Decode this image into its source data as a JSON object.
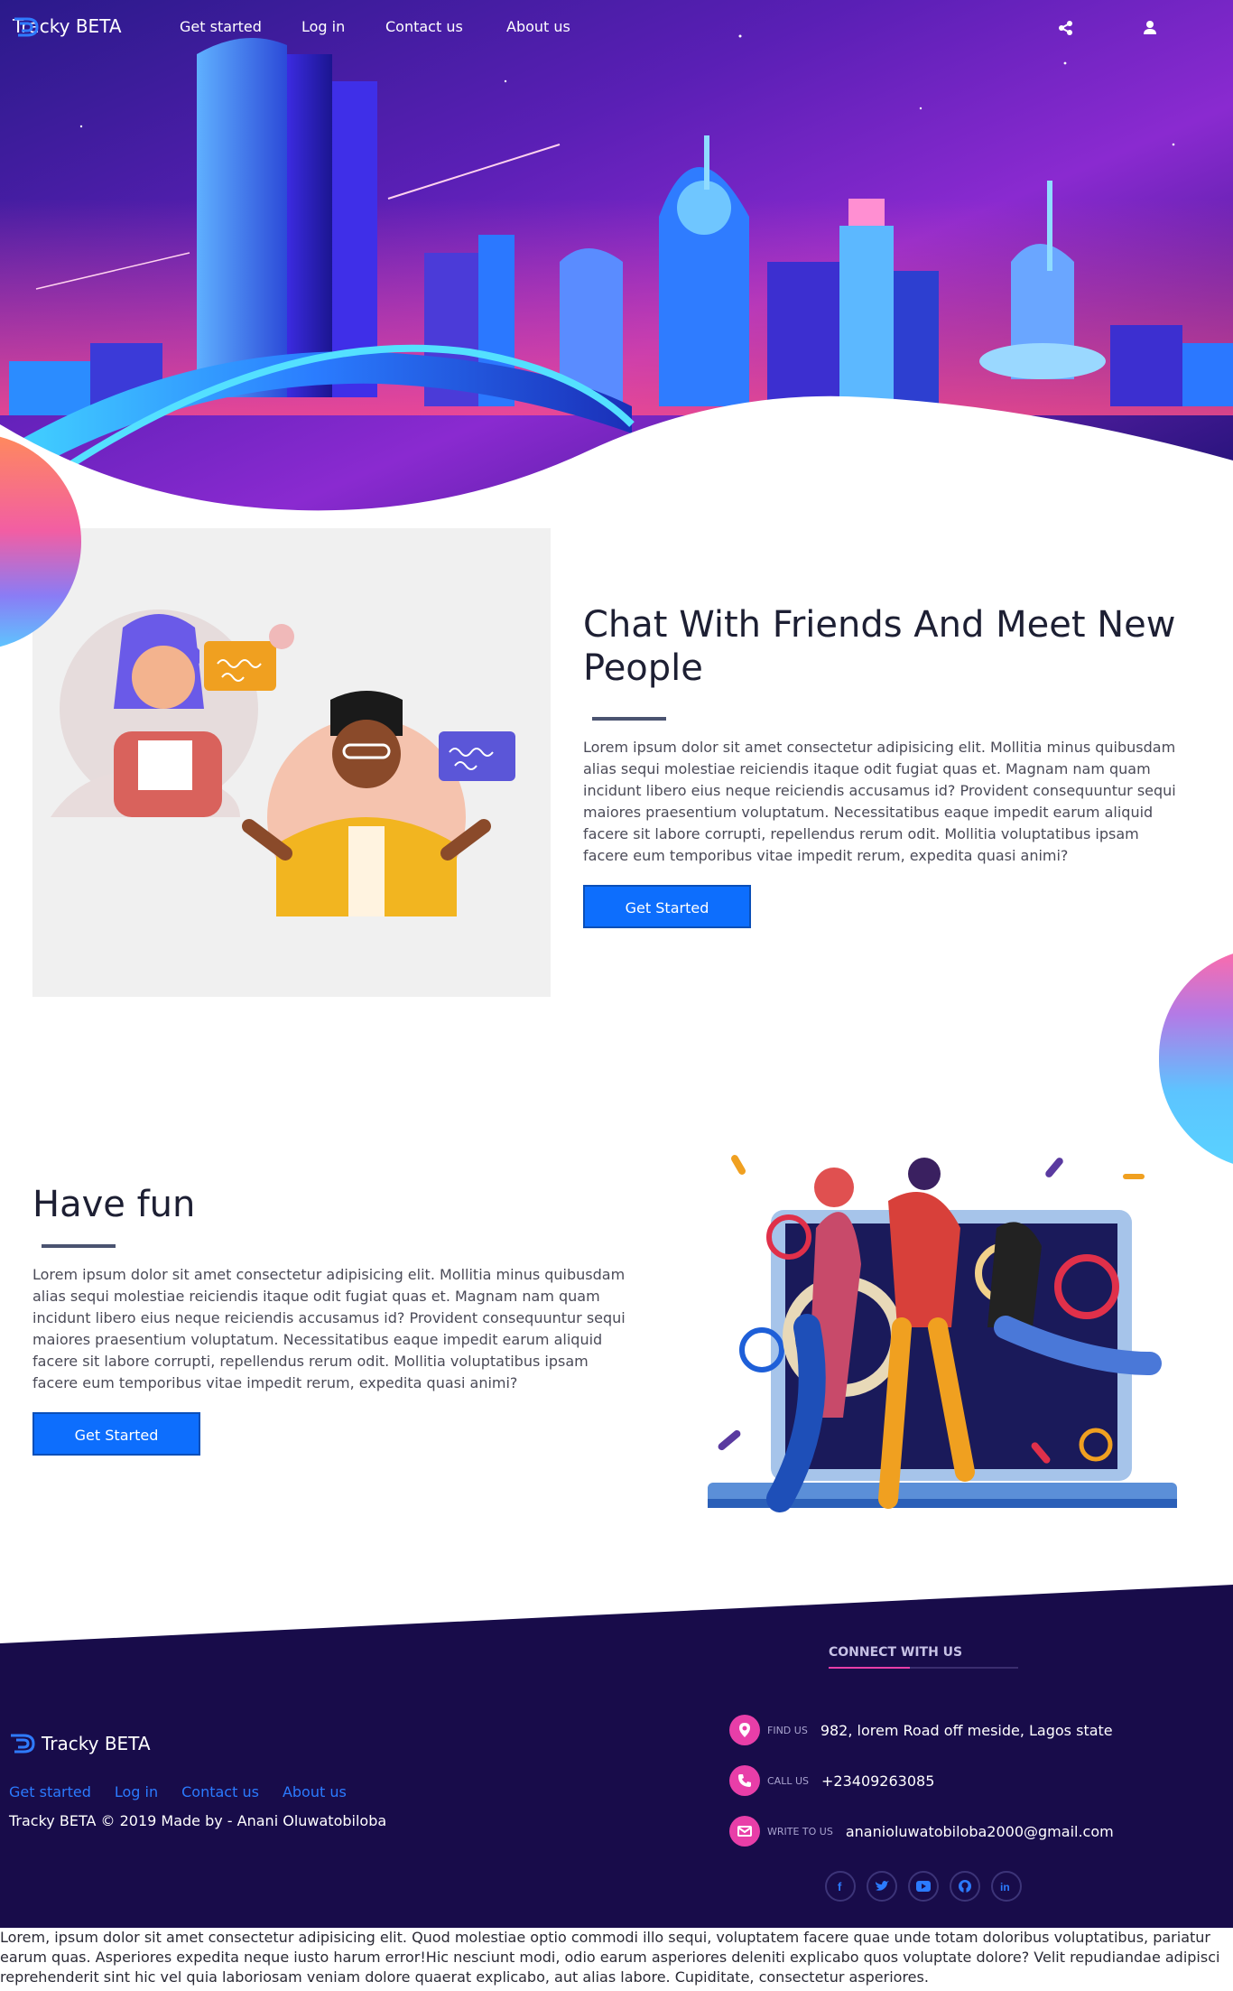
{
  "nav": {
    "brand": "Tracky BETA",
    "links": [
      "Get started",
      "Log in",
      "Contact us",
      "About us"
    ],
    "share_icon": "share-icon",
    "user_icon": "user-icon"
  },
  "section_chat": {
    "title": "Chat With Friends And Meet New People",
    "body": "Lorem ipsum dolor sit amet consectetur adipisicing elit. Mollitia minus quibusdam alias sequi molestiae reiciendis itaque odit fugiat quas et. Magnam nam quam incidunt libero eius neque reiciendis accusamus id? Provident consequuntur sequi maiores praesentium voluptatum. Necessitatibus eaque impedit earum aliquid facere sit labore corrupti, repellendus rerum odit. Mollitia voluptatibus ipsam facere eum temporibus vitae impedit rerum, expedita quasi animi?",
    "button": "Get Started"
  },
  "section_fun": {
    "title": "Have fun",
    "body": "Lorem ipsum dolor sit amet consectetur adipisicing elit. Mollitia minus quibusdam alias sequi molestiae reiciendis itaque odit fugiat quas et. Magnam nam quam incidunt libero eius neque reiciendis accusamus id? Provident consequuntur sequi maiores praesentium voluptatum. Necessitatibus eaque impedit earum aliquid facere sit labore corrupti, repellendus rerum odit. Mollitia voluptatibus ipsam facere eum temporibus vitae impedit rerum, expedita quasi animi?",
    "button": "Get Started"
  },
  "footer": {
    "brand": "Tracky BETA",
    "links": [
      "Get started",
      "Log in",
      "Contact us",
      "About us"
    ],
    "copyright": "Tracky BETA © 2019 Made by - Anani Oluwatobiloba",
    "connect_title": "CONNECT WITH US",
    "contacts": [
      {
        "label": "FIND US",
        "value": "982, lorem Road off meside, Lagos state",
        "icon": "map-pin-icon"
      },
      {
        "label": "CALL US",
        "value": "+23409263085",
        "icon": "phone-icon"
      },
      {
        "label": "WRITE TO US",
        "value": "ananioluwatobiloba2000@gmail.com",
        "icon": "envelope-icon"
      }
    ],
    "socials": [
      "f",
      "twitter-icon",
      "youtube-icon",
      "github-icon",
      "in"
    ]
  },
  "bottom_text": "Lorem, ipsum dolor sit amet consectetur adipisicing elit. Quod molestiae optio commodi illo sequi, voluptatem facere quae unde totam doloribus voluptatibus, pariatur earum quas. Asperiores expedita neque iusto harum error!Hic nesciunt modi, odio earum asperiores deleniti explicabo quos voluptate dolore? Velit repudiandae adipisci reprehenderit sint hic vel quia laboriosam veniam dolore quaerat explicabo, aut alias labore. Cupiditate, consectetur asperiores.",
  "colors": {
    "accent": "#0d6efd",
    "footer_bg": "#180c4a",
    "pink": "#e83ea8"
  }
}
